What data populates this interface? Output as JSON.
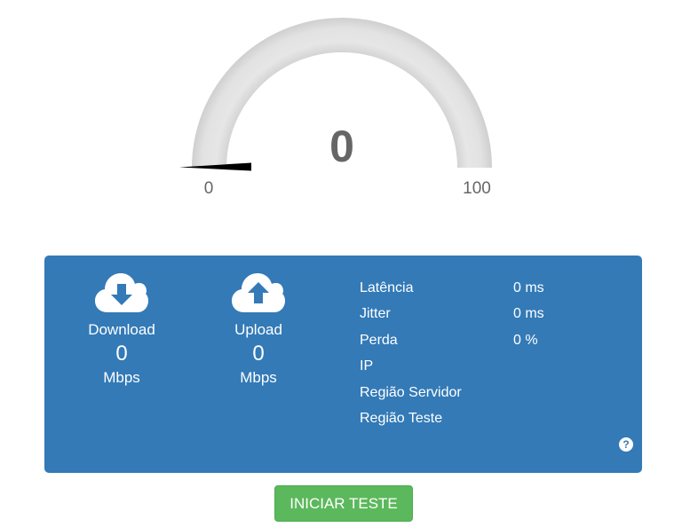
{
  "gauge": {
    "value": "0",
    "min_label": "0",
    "max_label": "100",
    "min": 0,
    "max": 100,
    "current": 0,
    "track_color": "#e0e0e0",
    "needle_color": "#000000"
  },
  "panel": {
    "background": "#337ab7",
    "download": {
      "icon": "cloud-download-icon",
      "label": "Download",
      "value": "0",
      "unit": "Mbps"
    },
    "upload": {
      "icon": "cloud-upload-icon",
      "label": "Upload",
      "value": "0",
      "unit": "Mbps"
    },
    "stats": [
      {
        "label": "Latência",
        "value": "0 ms"
      },
      {
        "label": "Jitter",
        "value": "0 ms"
      },
      {
        "label": "Perda",
        "value": "0 %"
      },
      {
        "label": "IP",
        "value": ""
      },
      {
        "label": "Região Servidor",
        "value": ""
      },
      {
        "label": "Região Teste",
        "value": ""
      }
    ],
    "help_icon": "question-circle-icon",
    "help_glyph": "?"
  },
  "start_button": {
    "label": "INICIAR TESTE",
    "color": "#5cb85c"
  }
}
